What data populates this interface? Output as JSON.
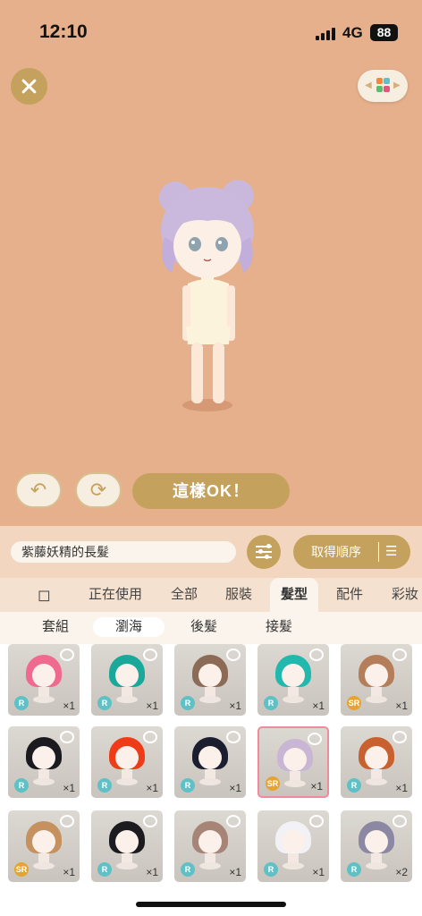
{
  "status": {
    "time": "12:10",
    "network": "4G",
    "battery": "88"
  },
  "avatar": {
    "name_text": "紫藤妖精的長髮"
  },
  "actions": {
    "ok_label": "這樣OK！",
    "order_label": "取得順序"
  },
  "tabs": [
    "正在使用",
    "全部",
    "服裝",
    "髮型",
    "配件",
    "彩妝"
  ],
  "active_tab": "髮型",
  "subtabs": [
    "套組",
    "瀏海",
    "後髮",
    "接髮"
  ],
  "active_subtab": "瀏海",
  "items": [
    {
      "rarity": "R",
      "qty": "×1",
      "hair": "#f06a8f"
    },
    {
      "rarity": "R",
      "qty": "×1",
      "hair": "#1aa89a"
    },
    {
      "rarity": "R",
      "qty": "×1",
      "hair": "#8b6b55"
    },
    {
      "rarity": "R",
      "qty": "×1",
      "hair": "#22b8ad"
    },
    {
      "rarity": "SR",
      "qty": "×1",
      "hair": "#b57e5a"
    },
    {
      "rarity": "R",
      "qty": "×1",
      "hair": "#1b1b1f"
    },
    {
      "rarity": "R",
      "qty": "×1",
      "hair": "#ee3b18"
    },
    {
      "rarity": "R",
      "qty": "×1",
      "hair": "#1a1e2e"
    },
    {
      "rarity": "SR",
      "qty": "×1",
      "hair": "#c9b5d4"
    },
    {
      "rarity": "R",
      "qty": "×1",
      "hair": "#c9602f"
    },
    {
      "rarity": "SR",
      "qty": "×1",
      "hair": "#c4915f"
    },
    {
      "rarity": "R",
      "qty": "×1",
      "hair": "#1c1b20"
    },
    {
      "rarity": "R",
      "qty": "×1",
      "hair": "#a68476"
    },
    {
      "rarity": "R",
      "qty": "×1",
      "hair": "#f2f2f6"
    },
    {
      "rarity": "R",
      "qty": "×2",
      "hair": "#8c88a3"
    }
  ],
  "colors": {
    "accent": "#c4a25d",
    "background": "#e5b08b",
    "selected_border": "#f08a9e"
  },
  "icons": [
    "close-icon",
    "outfit-grid-icon",
    "undo-icon",
    "rotate-icon",
    "filter-icon",
    "sort-icon",
    "bookmark-icon",
    "bear-icon"
  ]
}
